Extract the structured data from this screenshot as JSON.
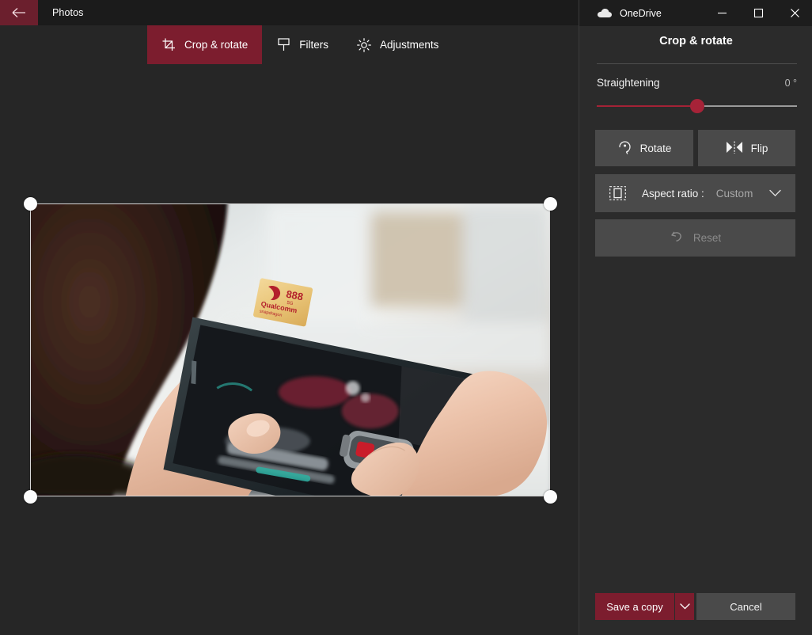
{
  "photos_window": {
    "app_title": "Photos",
    "back_icon": "back-arrow-icon",
    "titlebar_accent": "#6b1f2d",
    "tabs": [
      {
        "label": "Crop & rotate",
        "icon": "crop-icon",
        "active": true
      },
      {
        "label": "Filters",
        "icon": "filter-icon",
        "active": false
      },
      {
        "label": "Adjustments",
        "icon": "brightness-icon",
        "active": false
      }
    ],
    "history": {
      "undo_icon": "undo-arrow-icon",
      "redo_icon": "redo-arrow-icon",
      "undo_enabled": false,
      "redo_enabled": false
    },
    "canvas": {
      "crop_overlay_name": "crop-selection",
      "handle_icon": "crop-handle-circle",
      "photo_description": "Hands holding a smartphone displaying a game, Snapdragon 888 5G badge on screen",
      "photo_badge": {
        "model": "888",
        "sub": "5G",
        "brand": "Qualcomm",
        "brand_sub": "snapdragon"
      }
    }
  },
  "onedrive_panel": {
    "title": "OneDrive",
    "cloud_icon": "cloud-icon",
    "window_controls": [
      {
        "name": "minimize-button",
        "glyph": "─"
      },
      {
        "name": "maximize-button",
        "glyph": "☐"
      },
      {
        "name": "close-button",
        "glyph": "✕"
      }
    ],
    "heading": "Crop & rotate",
    "straightening": {
      "label": "Straightening",
      "value": "0 °",
      "slider_percent": 50,
      "accent_color": "#a62338"
    },
    "buttons": {
      "rotate": {
        "label": "Rotate",
        "icon": "rotate-icon"
      },
      "flip": {
        "label": "Flip",
        "icon": "flip-icon"
      },
      "aspect_ratio": {
        "label": "Aspect ratio :",
        "value": "Custom",
        "icon": "aspect-ratio-icon",
        "chevron": "chevron-down-icon"
      },
      "reset": {
        "label": "Reset",
        "icon": "reset-icon",
        "enabled": false
      }
    },
    "footer": {
      "save_label": "Save a copy",
      "save_caret": "chevron-down-icon",
      "cancel_label": "Cancel",
      "save_color": "#7c1d2e"
    }
  }
}
